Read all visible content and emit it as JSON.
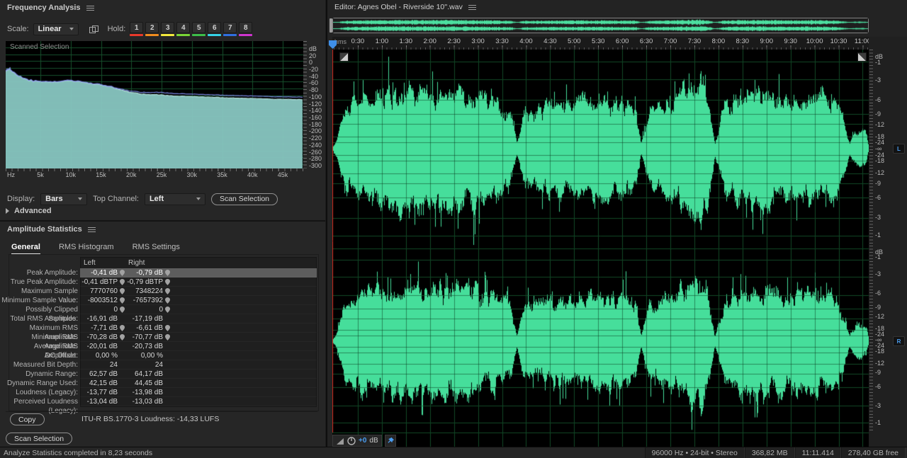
{
  "frequency_analysis": {
    "title": "Frequency Analysis",
    "scale_label": "Scale:",
    "scale_value": "Linear",
    "hold_label": "Hold:",
    "holds": [
      {
        "label": "1",
        "color": "#e8392b"
      },
      {
        "label": "2",
        "color": "#f08c1e"
      },
      {
        "label": "3",
        "color": "#f2e83c"
      },
      {
        "label": "4",
        "color": "#79d636"
      },
      {
        "label": "5",
        "color": "#3dbf4a"
      },
      {
        "label": "6",
        "color": "#35d3e8"
      },
      {
        "label": "7",
        "color": "#2f6fe0"
      },
      {
        "label": "8",
        "color": "#cf35cf"
      }
    ],
    "overlay_label": "Scanned Selection",
    "y_ticks": [
      "dB",
      "20",
      "0",
      "-20",
      "-40",
      "-60",
      "-80",
      "-100",
      "-120",
      "-140",
      "-160",
      "-180",
      "-200",
      "-220",
      "-240",
      "-260",
      "-280",
      "-300"
    ],
    "x_ticks": [
      "Hz",
      "5k",
      "10k",
      "15k",
      "20k",
      "25k",
      "30k",
      "35k",
      "40k",
      "45k"
    ],
    "display_label": "Display:",
    "display_value": "Bars",
    "top_channel_label": "Top Channel:",
    "top_channel_value": "Left",
    "scan_button": "Scan Selection",
    "advanced_label": "Advanced",
    "spectrum_db_by_khz": [
      [
        0,
        -26
      ],
      [
        0.5,
        -33
      ],
      [
        1,
        -38
      ],
      [
        1.5,
        -44
      ],
      [
        2,
        -49
      ],
      [
        3,
        -56
      ],
      [
        4,
        -59
      ],
      [
        5,
        -61
      ],
      [
        6,
        -62
      ],
      [
        7,
        -62
      ],
      [
        8,
        -60
      ],
      [
        9,
        -58
      ],
      [
        10,
        -58
      ],
      [
        11,
        -60
      ],
      [
        12,
        -62
      ],
      [
        13,
        -64
      ],
      [
        14,
        -67
      ],
      [
        15,
        -70
      ],
      [
        16,
        -73
      ],
      [
        17,
        -77
      ],
      [
        18,
        -82
      ],
      [
        19,
        -87
      ],
      [
        20,
        -91
      ],
      [
        21,
        -94
      ],
      [
        22,
        -96
      ],
      [
        24,
        -98
      ],
      [
        26,
        -100
      ],
      [
        28,
        -102
      ],
      [
        30,
        -103
      ],
      [
        33,
        -105
      ],
      [
        36,
        -107
      ],
      [
        40,
        -109
      ],
      [
        44,
        -111
      ],
      [
        48,
        -112
      ]
    ]
  },
  "amplitude_statistics": {
    "title": "Amplitude Statistics",
    "tabs": [
      "General",
      "RMS Histogram",
      "RMS Settings"
    ],
    "active_tab": "General",
    "columns": [
      "Left",
      "Right"
    ],
    "rows": [
      {
        "label": "Peak Amplitude:",
        "left": "-0,41 dB",
        "right": "-0,79 dB",
        "pin": true,
        "selected": true
      },
      {
        "label": "True Peak Amplitude:",
        "left": "-0,41 dBTP",
        "right": "-0,79 dBTP",
        "pin": true,
        "selected": false
      },
      {
        "label": "Maximum Sample Value:",
        "left": "7770760",
        "right": "7348224",
        "pin": true,
        "selected": false
      },
      {
        "label": "Minimum Sample Value:",
        "left": "-8003512",
        "right": "-7657392",
        "pin": true,
        "selected": false
      },
      {
        "label": "Possibly Clipped Samples:",
        "left": "0",
        "right": "0",
        "pin": true,
        "selected": false
      },
      {
        "label": "Total RMS Amplitude:",
        "left": "-16,91 dB",
        "right": "-17,19 dB",
        "pin": false,
        "selected": false
      },
      {
        "label": "Maximum RMS Amplitude:",
        "left": "-7,71 dB",
        "right": "-6,61 dB",
        "pin": true,
        "selected": false
      },
      {
        "label": "Minimum RMS Amplitude:",
        "left": "-70,28 dB",
        "right": "-70,77 dB",
        "pin": true,
        "selected": false
      },
      {
        "label": "Average RMS Amplitude:",
        "left": "-20,01 dB",
        "right": "-20,73 dB",
        "pin": false,
        "selected": false
      },
      {
        "label": "DC Offset:",
        "left": "0,00 %",
        "right": "0,00 %",
        "pin": false,
        "selected": false
      },
      {
        "label": "Measured Bit Depth:",
        "left": "24",
        "right": "24",
        "pin": false,
        "selected": false
      },
      {
        "label": "Dynamic Range:",
        "left": "62,57 dB",
        "right": "64,17 dB",
        "pin": false,
        "selected": false
      },
      {
        "label": "Dynamic Range Used:",
        "left": "42,15 dB",
        "right": "44,45 dB",
        "pin": false,
        "selected": false
      },
      {
        "label": "Loudness (Legacy):",
        "left": "-13,77 dB",
        "right": "-13,98 dB",
        "pin": false,
        "selected": false
      },
      {
        "label": "Perceived Loudness (Legacy):",
        "left": "-13,04 dB",
        "right": "-13,03 dB",
        "pin": false,
        "selected": false
      }
    ],
    "copy_button": "Copy",
    "loudness_summary": "ITU-R BS.1770-3 Loudness:  -14,33 LUFS",
    "scan_button": "Scan Selection"
  },
  "editor": {
    "title": "Editor: Agnes Obel - Riverside 10''.wav",
    "timeline_unit": "hms",
    "timeline_ticks": [
      "0:30",
      "1:00",
      "1:30",
      "2:00",
      "2:30",
      "3:00",
      "3:30",
      "4:00",
      "4:30",
      "5:00",
      "5:30",
      "6:00",
      "6:30",
      "7:00",
      "7:30",
      "8:00",
      "8:30",
      "9:00",
      "9:30",
      "10:00",
      "10:30",
      "11:00"
    ],
    "db_scale_top_label": "dB",
    "db_scale_side": [
      "1",
      "3",
      "6",
      "9",
      "12",
      "18",
      "24"
    ],
    "db_scale_center_label": "-∞",
    "channel_badges": [
      "L",
      "R"
    ],
    "headsup_gain": "+0",
    "headsup_unit": "dB",
    "duration_seconds": 669,
    "envelope": [
      [
        0,
        0.02
      ],
      [
        6,
        0.12
      ],
      [
        14,
        0.5
      ],
      [
        25,
        0.62
      ],
      [
        45,
        0.68
      ],
      [
        70,
        0.76
      ],
      [
        95,
        0.8
      ],
      [
        120,
        0.74
      ],
      [
        150,
        0.78
      ],
      [
        175,
        0.72
      ],
      [
        205,
        0.62
      ],
      [
        222,
        0.5
      ],
      [
        230,
        0.07
      ],
      [
        238,
        0.45
      ],
      [
        265,
        0.55
      ],
      [
        295,
        0.6
      ],
      [
        330,
        0.64
      ],
      [
        360,
        0.6
      ],
      [
        378,
        0.52
      ],
      [
        385,
        0.07
      ],
      [
        395,
        0.5
      ],
      [
        420,
        0.62
      ],
      [
        445,
        0.8
      ],
      [
        458,
        0.95
      ],
      [
        468,
        0.7
      ],
      [
        477,
        0.08
      ],
      [
        488,
        0.55
      ],
      [
        515,
        0.75
      ],
      [
        545,
        0.72
      ],
      [
        575,
        0.66
      ],
      [
        605,
        0.72
      ],
      [
        628,
        0.6
      ],
      [
        638,
        0.35
      ],
      [
        645,
        0.07
      ],
      [
        652,
        0.22
      ],
      [
        660,
        0.26
      ],
      [
        666,
        0.18
      ],
      [
        669,
        0.02
      ]
    ]
  },
  "status_bar": {
    "left_text": "Analyze Statistics completed in 8,23 seconds",
    "right_items": [
      "96000 Hz • 24-bit • Stereo",
      "368,82 MB",
      "11:11.414",
      "278,40 GB free"
    ]
  },
  "colors": {
    "waveform_green": "#46de9b",
    "overview_green": "#4ce0a0",
    "grid_green": "#1a5a32",
    "spectrum_fill": "#88c6c1",
    "spectrum_edge": "#b7e4df",
    "spectrum_line_alt": "#7d88e6",
    "playhead_red": "#cf2b20",
    "accent_blue": "#3f8fe8"
  }
}
